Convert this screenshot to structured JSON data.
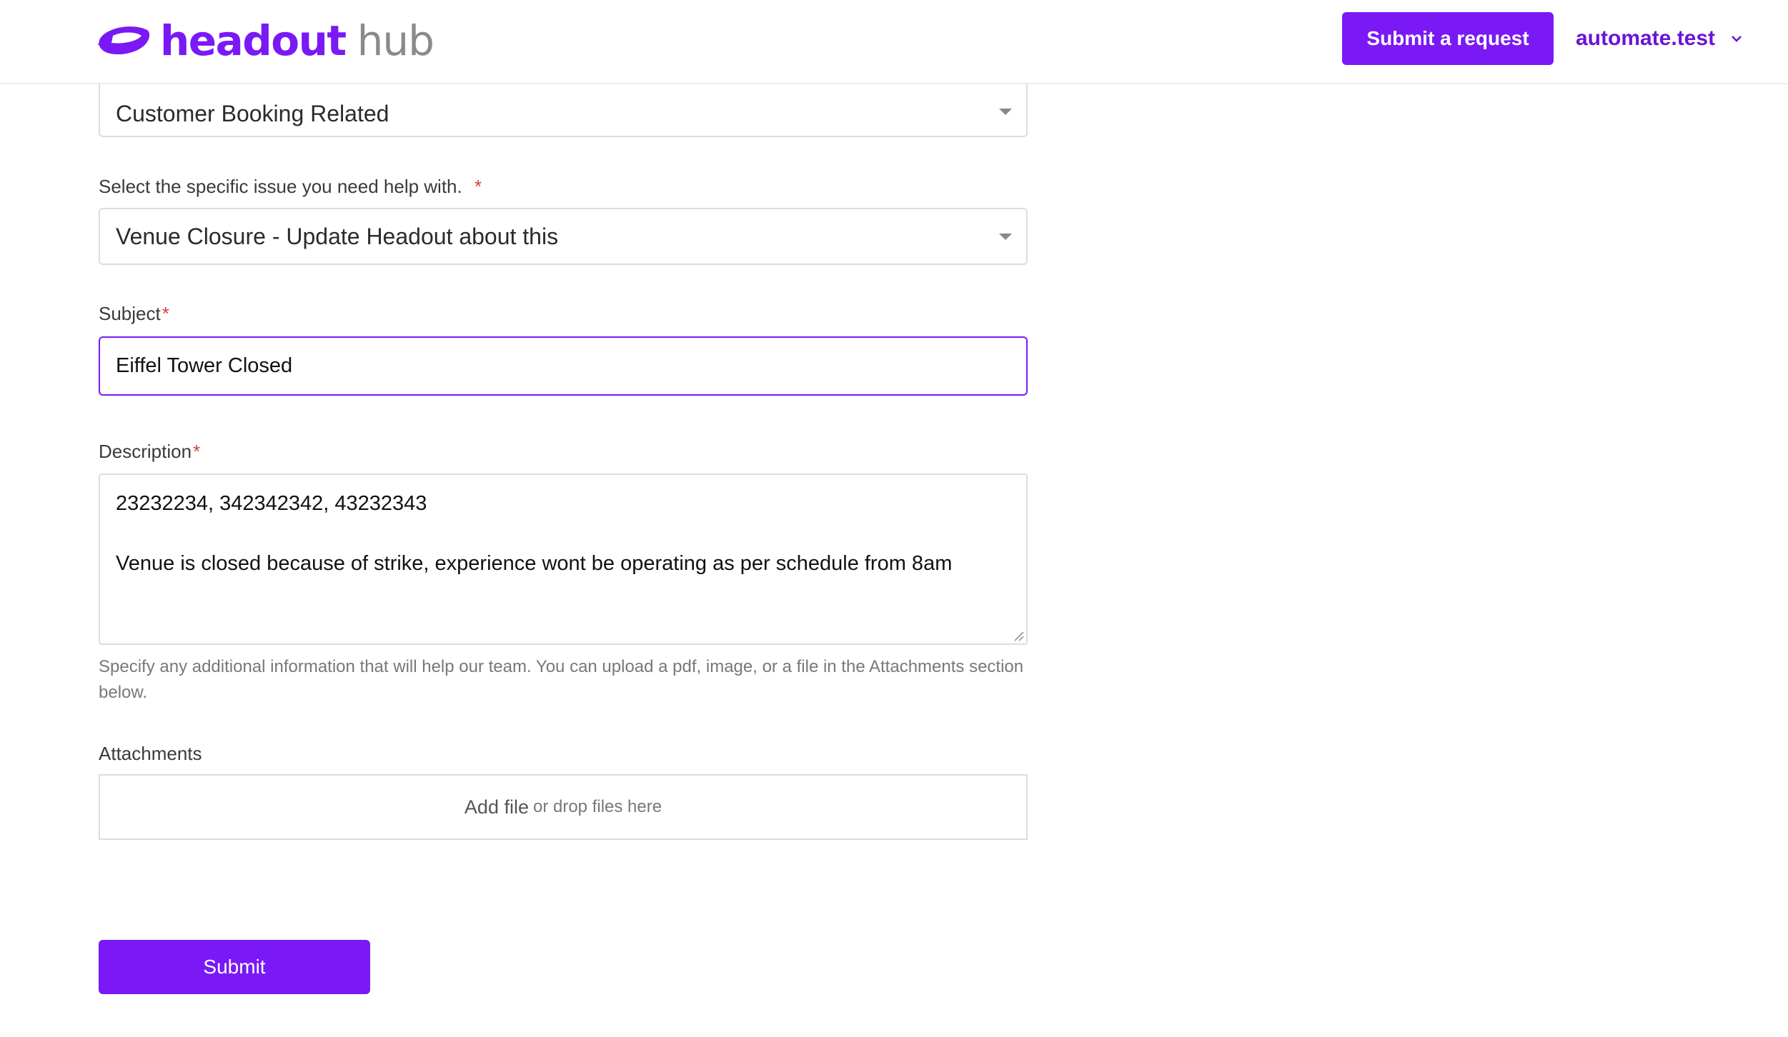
{
  "header": {
    "brand_name": "headout",
    "brand_suffix": "hub",
    "submit_request_label": "Submit a request",
    "user_name": "automate.test"
  },
  "form": {
    "category_select": {
      "value": "Customer Booking Related"
    },
    "issue_select": {
      "label": "Select the specific issue you need help with.",
      "required_mark": "*",
      "value": "Venue Closure - Update Headout about this"
    },
    "subject": {
      "label": "Subject",
      "required_mark": "*",
      "value": "Eiffel Tower Closed"
    },
    "description": {
      "label": "Description",
      "required_mark": "*",
      "lines": [
        "23232234, 342342342, 43232343",
        "",
        "Venue is closed because of strike, experience wont be operating as per schedule from 8am"
      ],
      "help_text": "Specify any additional information that will help our team. You can upload a pdf, image, or a file in the Attachments section below."
    },
    "attachments": {
      "label": "Attachments",
      "add_file_label": "Add file",
      "drop_text": "or drop files here"
    },
    "submit_label": "Submit"
  },
  "colors": {
    "brand_purple": "#7a19f5",
    "required_red": "#e03a3a"
  },
  "icons": {
    "brand_logo": "headout-logo-icon",
    "user_menu_chevron": "chevron-down-icon",
    "select_caret": "caret-down-icon",
    "textarea_resize": "resize-handle-icon"
  }
}
